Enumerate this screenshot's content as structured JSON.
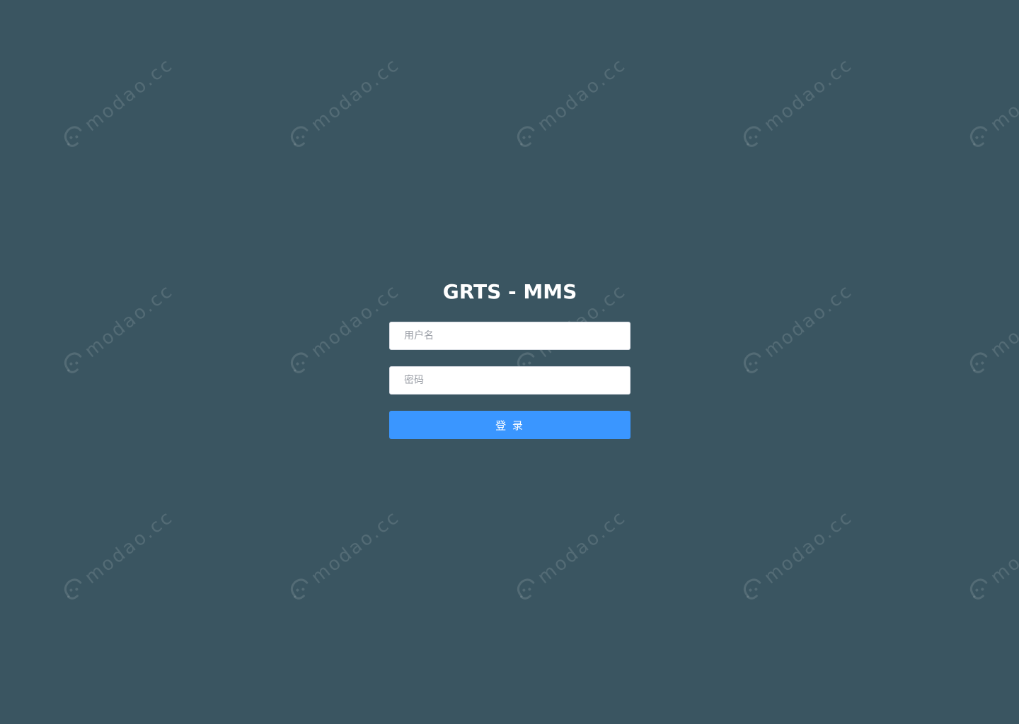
{
  "watermark": {
    "text": "modao.cc",
    "icon": "modao-logo-icon"
  },
  "login": {
    "title": "GRTS - MMS",
    "username_placeholder": "用户名",
    "username_value": "",
    "password_placeholder": "密码",
    "password_value": "",
    "submit_label": "登 录"
  },
  "colors": {
    "background": "#3a5561",
    "button": "#3a96ff",
    "input_bg": "#ffffff",
    "title": "#ffffff"
  }
}
